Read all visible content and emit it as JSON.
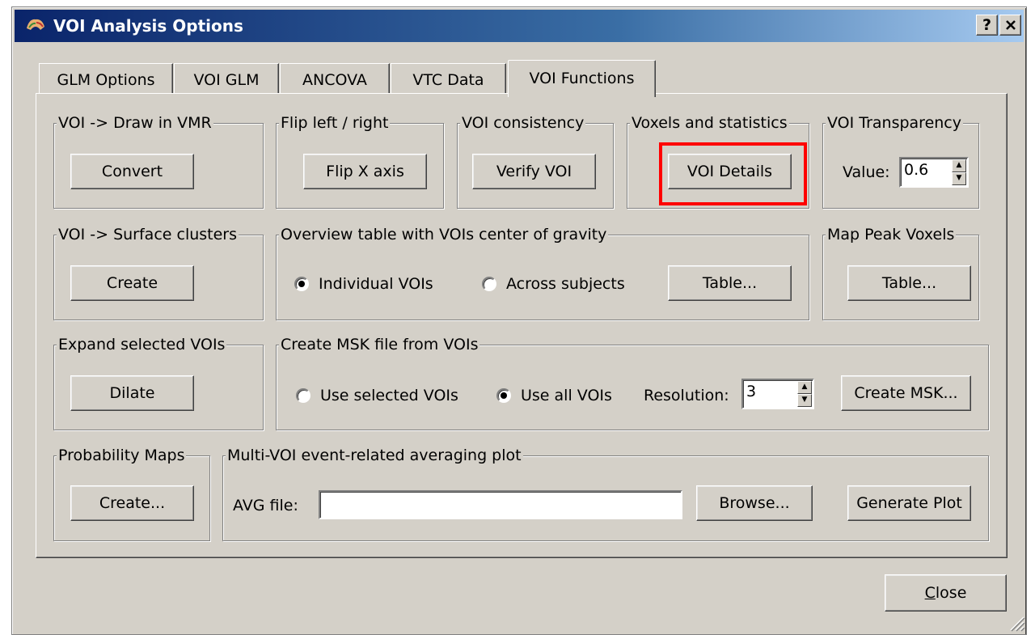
{
  "window": {
    "title": "VOI Analysis Options",
    "help_label": "?",
    "close_glyph": "✕",
    "app_icon": "brain-icon"
  },
  "tabs": [
    {
      "label": "GLM Options"
    },
    {
      "label": "VOI GLM"
    },
    {
      "label": "ANCOVA"
    },
    {
      "label": "VTC Data"
    },
    {
      "label": "VOI Functions",
      "active": true
    }
  ],
  "groups": {
    "draw_vmr": {
      "title": "VOI -> Draw in VMR",
      "button": "Convert"
    },
    "flip": {
      "title": "Flip left / right",
      "button": "Flip X axis"
    },
    "consistency": {
      "title": "VOI consistency",
      "button": "Verify VOI"
    },
    "voxels_stats": {
      "title": "Voxels and statistics",
      "button": "VOI Details"
    },
    "transparency": {
      "title": "VOI Transparency",
      "value_label": "Value:",
      "value": "0.6"
    },
    "surface_clusters": {
      "title": "VOI -> Surface clusters",
      "button": "Create"
    },
    "overview_table": {
      "title": "Overview table with VOIs center of gravity",
      "radio_individual": "Individual VOIs",
      "radio_across": "Across subjects",
      "button": "Table..."
    },
    "map_peak": {
      "title": "Map Peak Voxels",
      "button": "Table..."
    },
    "expand": {
      "title": "Expand selected VOIs",
      "button": "Dilate"
    },
    "msk": {
      "title": "Create MSK file from VOIs",
      "radio_selected": "Use selected VOIs",
      "radio_all": "Use all VOIs",
      "resolution_label": "Resolution:",
      "resolution_value": "3",
      "button": "Create MSK..."
    },
    "probability": {
      "title": "Probability Maps",
      "button": "Create..."
    },
    "multi_voi": {
      "title": "Multi-VOI event-related averaging plot",
      "avg_label": "AVG file:",
      "avg_value": "",
      "browse_button": "Browse...",
      "generate_button": "Generate Plot"
    }
  },
  "footer": {
    "close_button": "Close"
  },
  "colors": {
    "highlight": "#ff0000",
    "titlebar": "#0a246a",
    "face": "#d4d0c8"
  }
}
